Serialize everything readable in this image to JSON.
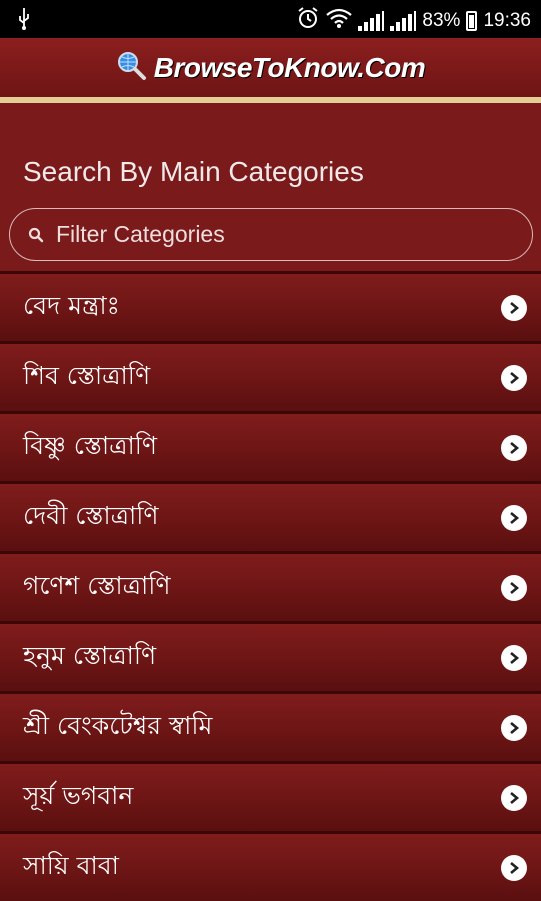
{
  "status_bar": {
    "battery": "83%",
    "time": "19:36"
  },
  "header": {
    "brand": "BrowseToKnow.Com"
  },
  "main": {
    "section_title": "Search By Main Categories",
    "search": {
      "placeholder": "Filter Categories",
      "value": ""
    },
    "categories": [
      {
        "label": "বেদ মন্ত্রাঃ"
      },
      {
        "label": "শিব স্তোত্রাণি"
      },
      {
        "label": "বিষ্ণু স্তোত্রাণি"
      },
      {
        "label": "দেবী স্তোত্রাণি"
      },
      {
        "label": "গণেশ স্তোত্রাণি"
      },
      {
        "label": "হনুম স্তোত্রাণি"
      },
      {
        "label": "শ্রী বেংকটেশ্বর স্বামি"
      },
      {
        "label": "সূর্য় ভগবান"
      },
      {
        "label": "সায়ি বাবা"
      }
    ]
  },
  "colors": {
    "background": "#7a1a1a",
    "accent_bar": "#e3cf95",
    "status_bar": "#000000"
  },
  "icons": {
    "usb": "usb-icon",
    "alarm": "alarm-icon",
    "wifi": "wifi-icon",
    "signal": "signal-icon",
    "battery": "battery-icon",
    "logo": "magnifier-globe-icon",
    "search": "search-icon",
    "row_arrow": "chevron-right-icon"
  }
}
